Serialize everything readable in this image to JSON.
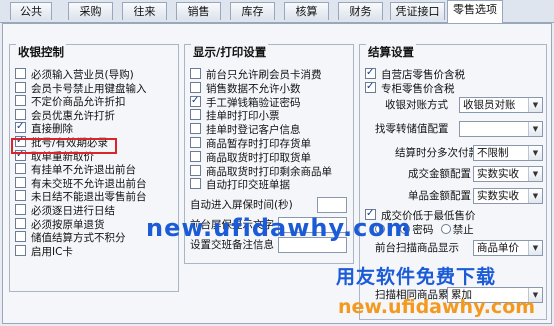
{
  "tabs": [
    "公共",
    "采购",
    "往来",
    "销售",
    "库存",
    "核算",
    "财务",
    "凭证接口",
    "零售选项"
  ],
  "active_tab": "零售选项",
  "cashier": {
    "title": "收银控制",
    "items": [
      {
        "label": "必须输入营业员(导购)",
        "checked": false
      },
      {
        "label": "会员卡号禁止用键盘输入",
        "checked": false
      },
      {
        "label": "不定价商品允许折扣",
        "checked": false
      },
      {
        "label": "会员优惠允许打折",
        "checked": false
      },
      {
        "label": "直接删除",
        "checked": true
      },
      {
        "label": "批号/有效期必录",
        "checked": true
      },
      {
        "label": "取单重新取价",
        "checked": true
      },
      {
        "label": "有挂单不允许退出前台",
        "checked": false
      },
      {
        "label": "有未交班不允许退出前台",
        "checked": false
      },
      {
        "label": "未日结不能退出零售前台",
        "checked": false
      },
      {
        "label": "必须逐日进行日结",
        "checked": false
      },
      {
        "label": "必须按原单退货",
        "checked": false
      },
      {
        "label": "储值结算方式不积分",
        "checked": false
      },
      {
        "label": "启用IC卡",
        "checked": false
      }
    ]
  },
  "display": {
    "title": "显示/打印设置",
    "items": [
      {
        "label": "前台只允许刷会员卡消费",
        "checked": false
      },
      {
        "label": "销售数据不允许小数",
        "checked": false
      },
      {
        "label": "手工弹钱箱验证密码",
        "checked": true
      },
      {
        "label": "挂单时打印小票",
        "checked": false
      },
      {
        "label": "挂单时登记客户信息",
        "checked": false
      },
      {
        "label": "商品暂存时打印存货单",
        "checked": false
      },
      {
        "label": "商品取货时打印取货单",
        "checked": false
      },
      {
        "label": "商品取货时打印剩余商品单",
        "checked": false
      },
      {
        "label": "自动打印交班单据",
        "checked": false
      }
    ],
    "lock_label": "自动进入屏保时间(秒)",
    "frontend_label": "前台屏保显示文字",
    "shift_label": "设置交班备注信息"
  },
  "settle": {
    "title": "结算设置",
    "items": [
      {
        "label": "自营店零售价含税",
        "checked": true
      },
      {
        "label": "专柜零售价含税",
        "checked": true
      }
    ],
    "rows": [
      {
        "label": "收银对账方式",
        "value": "收银员对账"
      },
      {
        "label": "找零转储值配置",
        "value": ""
      },
      {
        "label": "结算时分多次付款",
        "value": "不限制"
      },
      {
        "label": "成交金额配置",
        "value": "实数实收"
      },
      {
        "label": "单品金额配置",
        "value": "实数实收"
      }
    ],
    "min_price": {
      "label": "成交价低于最低售价",
      "checked": true
    },
    "password_label": "密码",
    "forbid_label": "禁止",
    "scan_label": "前台扫描商品显示",
    "scan_value": "商品单价",
    "merge_label": "扫描相同商品累加",
    "merge_value": "累加"
  },
  "watermark": {
    "url1": "new.ufidawhy.com",
    "slogan": "用友软件免费下载",
    "url2": "new.ufidawhy.com"
  },
  "colors": {
    "highlight": "#d9262b",
    "wm_blue": "#1c5bd6",
    "wm_orange": "#f39a1e",
    "accent": "#1a3a9a"
  }
}
